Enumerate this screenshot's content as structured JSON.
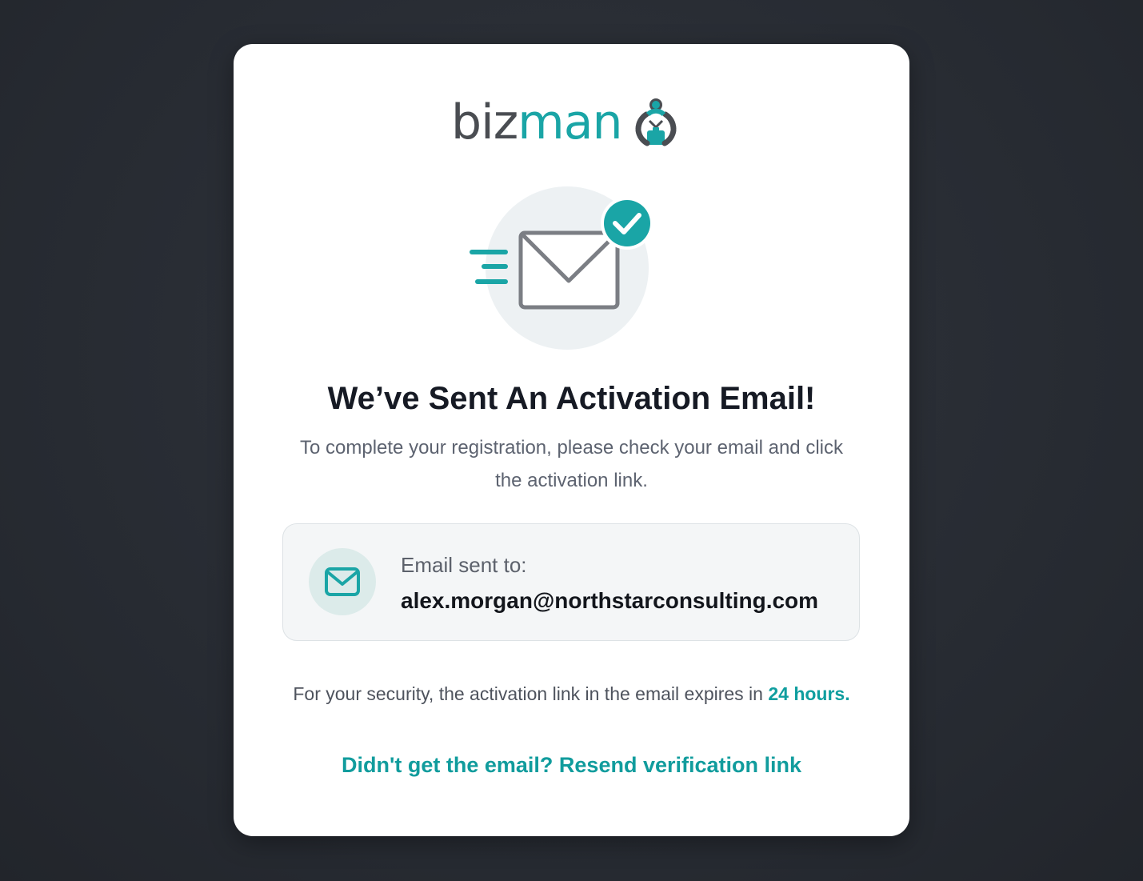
{
  "brand": {
    "name_dark": "biz",
    "name_accent": "man",
    "accent_color": "#1aa5a6",
    "dark_color": "#4a4d52"
  },
  "hero": {
    "icon": "envelope-sent-check-icon"
  },
  "title": "We’ve Sent An Activation Email!",
  "subtitle": "To complete your registration, please check your email and click the activation link.",
  "sent_to": {
    "icon": "mail-icon",
    "label": "Email sent to:",
    "email": "alex.morgan@northstarconsulting.com"
  },
  "security": {
    "text": "For your security, the activation link in the email expires in ",
    "highlight": "24 hours."
  },
  "resend_link": "Didn't get the email? Resend verification link"
}
